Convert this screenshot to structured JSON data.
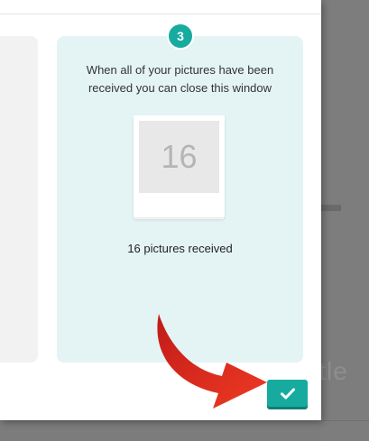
{
  "modal": {
    "step": {
      "number": "3",
      "instruction_line1": "When all of your pictures have been",
      "instruction_line2": "received you can close this window",
      "photo_count": "16",
      "status": "16 pictures received"
    },
    "confirm_button": {
      "icon": "check-icon"
    }
  },
  "background_page": {
    "visible_text": "itle"
  },
  "colors": {
    "accent": "#17aba0",
    "step_panel_bg": "#e4f4f4",
    "arrow": "#e53222"
  }
}
